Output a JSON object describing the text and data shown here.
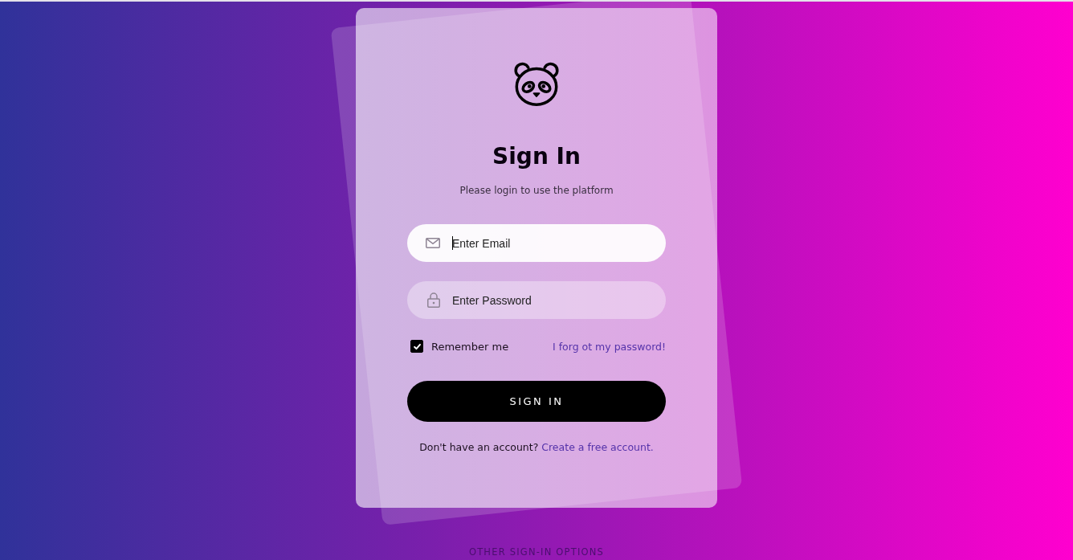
{
  "card": {
    "title": "Sign In",
    "subtitle": "Please login to use the platform",
    "fields": [
      {
        "kind": "email",
        "placeholder": "Enter Email",
        "focused": true
      },
      {
        "kind": "password",
        "placeholder": "Enter Password",
        "focused": false
      }
    ],
    "remember": {
      "label": "Remember me",
      "checked": true
    },
    "forgot_link": "I forg ot my password!",
    "submit_button": "SIGN IN",
    "signup": {
      "text": "Don't have an account?",
      "link": "Create a free account."
    }
  },
  "other_options": {
    "label": "OTHER SIGN-IN OPTIONS"
  }
}
